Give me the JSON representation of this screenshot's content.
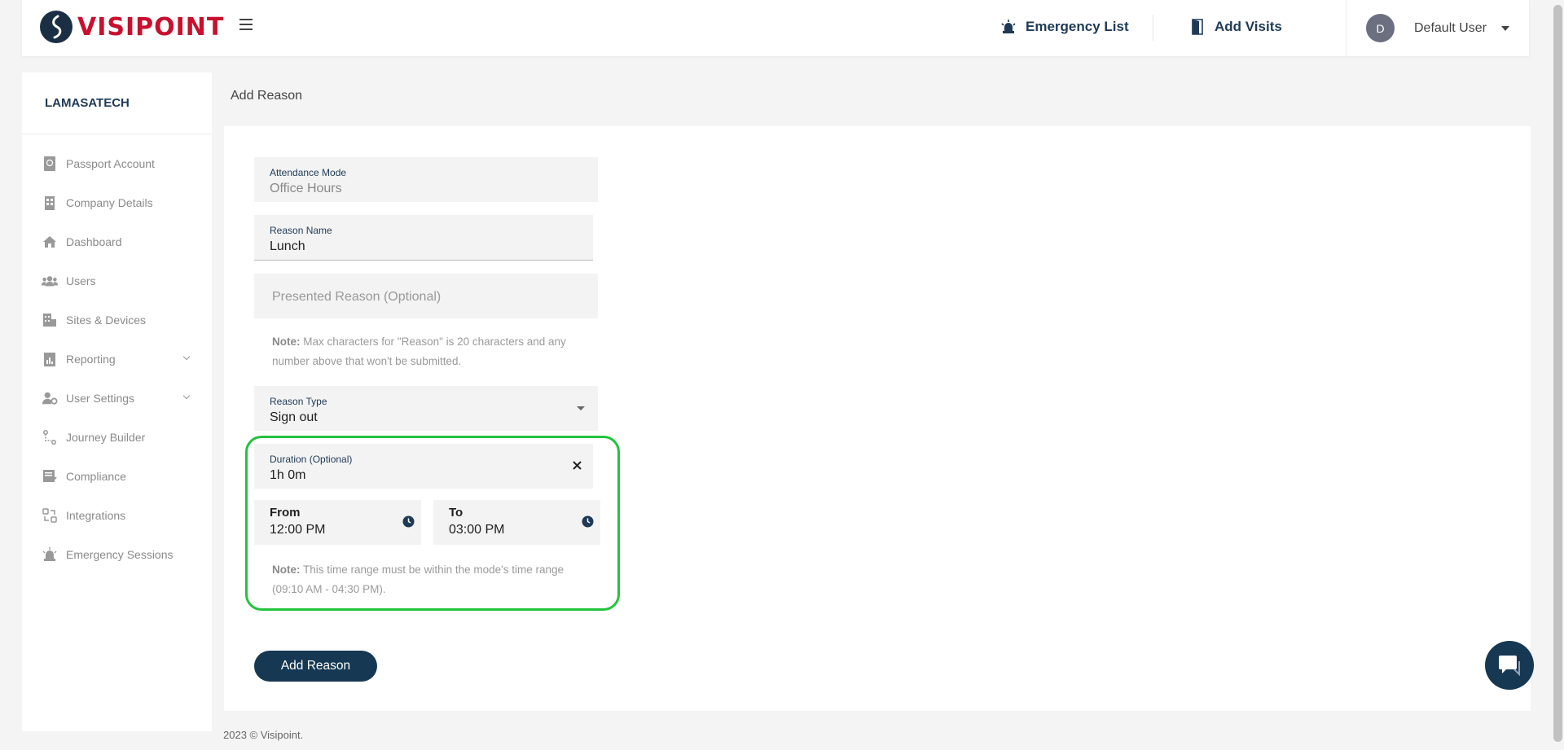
{
  "header": {
    "logo_text": "VISIPOINT",
    "emergency_list": "Emergency List",
    "add_visits": "Add Visits",
    "user_initial": "D",
    "user_name": "Default User"
  },
  "sidebar": {
    "org_name": "LAMASATECH",
    "items": [
      {
        "label": "Passport Account"
      },
      {
        "label": "Company Details"
      },
      {
        "label": "Dashboard"
      },
      {
        "label": "Users"
      },
      {
        "label": "Sites & Devices"
      },
      {
        "label": "Reporting"
      },
      {
        "label": "User Settings"
      },
      {
        "label": "Journey Builder"
      },
      {
        "label": "Compliance"
      },
      {
        "label": "Integrations"
      },
      {
        "label": "Emergency Sessions"
      }
    ]
  },
  "breadcrumb": "Add Reason",
  "form": {
    "attendance_mode_label": "Attendance Mode",
    "attendance_mode_value": "Office Hours",
    "reason_name_label": "Reason Name",
    "reason_name_value": "Lunch",
    "presented_reason_placeholder": "Presented Reason (Optional)",
    "note1_label": "Note:",
    "note1_line1": " Max characters for \"Reason\" is 20 characters and any",
    "note1_line2": "number above that won't be submitted.",
    "reason_type_label": "Reason Type",
    "reason_type_value": "Sign out",
    "duration_label": "Duration (Optional)",
    "duration_value": "1h 0m",
    "from_label": "From",
    "from_value": "12:00 PM",
    "to_label": "To",
    "to_value": "03:00 PM",
    "note2_label": "Note:",
    "note2_line1": " This time range must be within the mode's time range",
    "note2_line2": "(09:10 AM - 04:30 PM).",
    "submit_label": "Add Reason"
  },
  "footer": "2023 © Visipoint.",
  "colors": {
    "primary": "#163853",
    "brand_red": "#c8102e",
    "highlight": "#22c43d"
  }
}
